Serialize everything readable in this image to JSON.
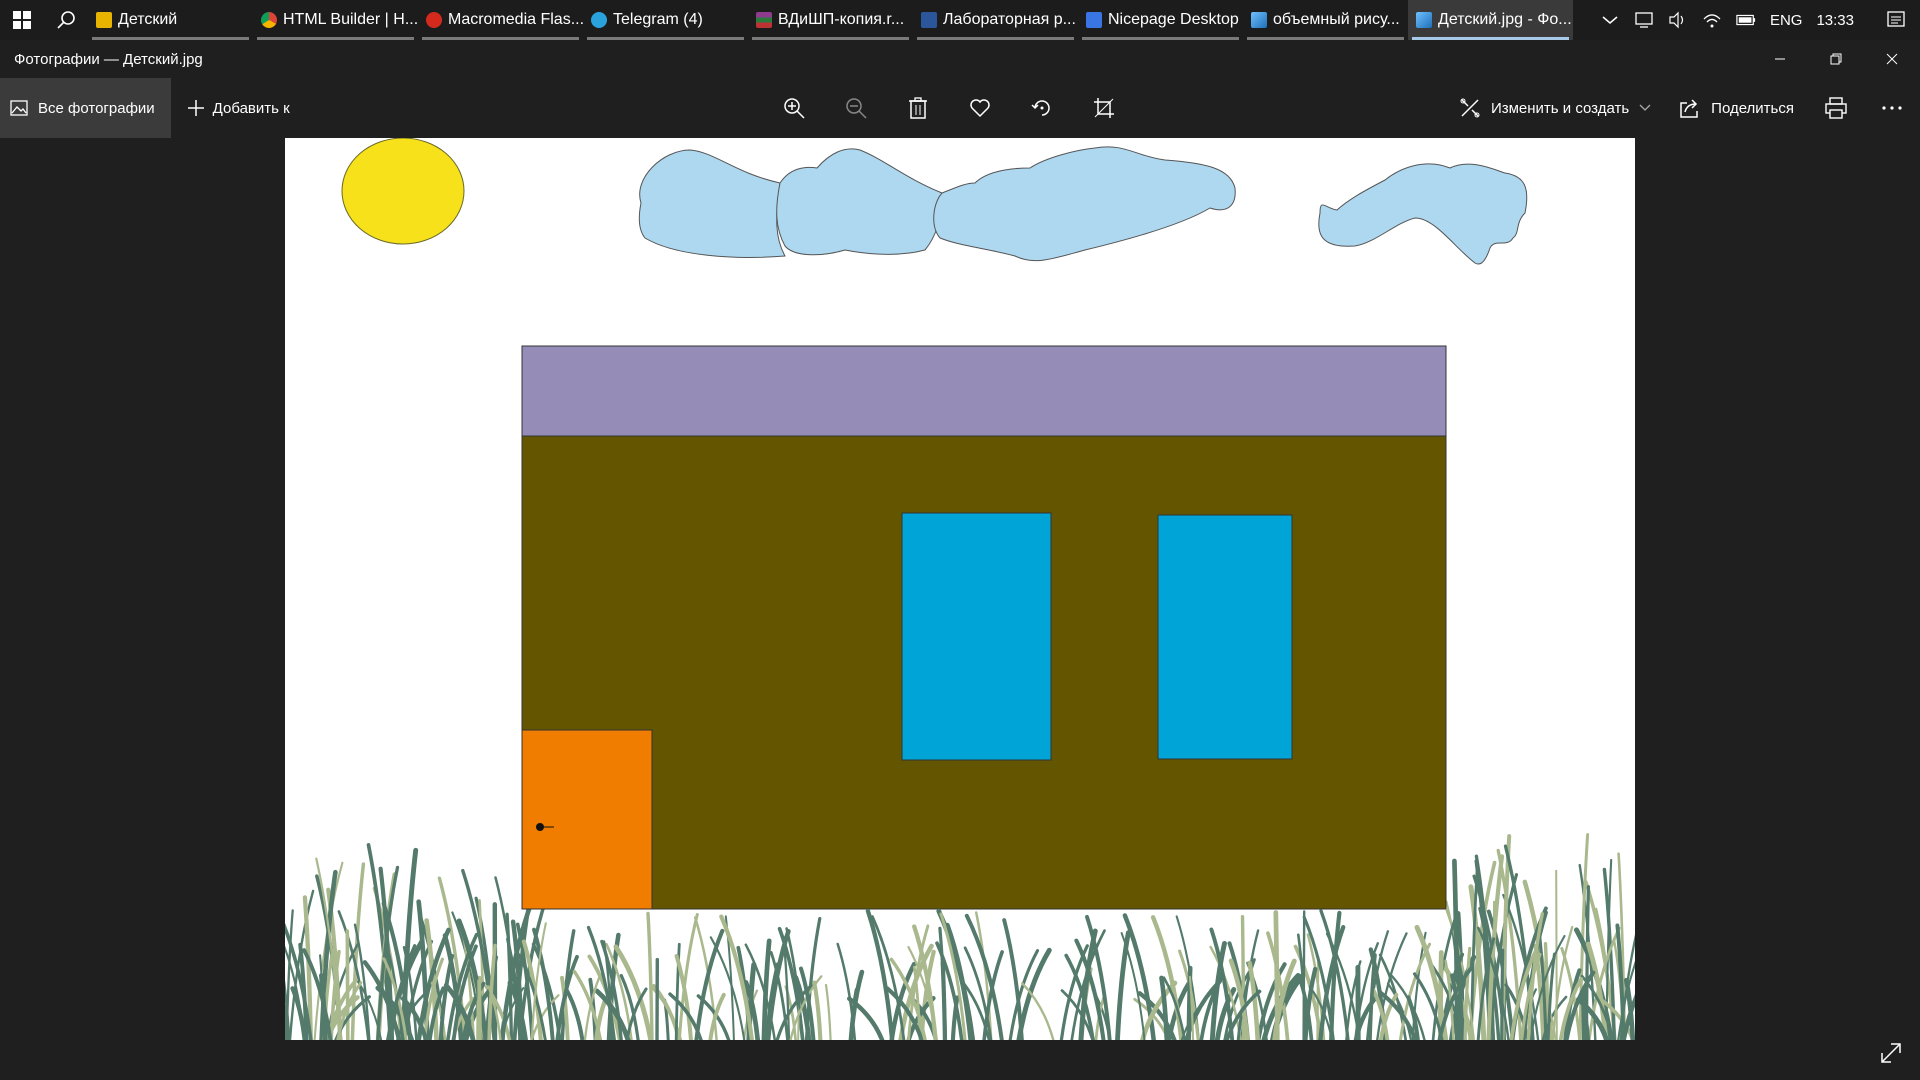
{
  "taskbar": {
    "tasks": [
      {
        "label": "Детский",
        "icon": "folder-icon",
        "color": "#e8b400"
      },
      {
        "label": "HTML Builder | H...",
        "icon": "chrome-icon",
        "color": "#4285f4"
      },
      {
        "label": "Macromedia Flas...",
        "icon": "flash-icon",
        "color": "#d42a1e"
      },
      {
        "label": "Telegram (4)",
        "icon": "telegram-icon",
        "color": "#2aa3dd"
      },
      {
        "label": "ВДиШП-копия.r...",
        "icon": "winrar-icon",
        "color": "#8e3b8e"
      },
      {
        "label": "Лабораторная р...",
        "icon": "word-icon",
        "color": "#2b579a"
      },
      {
        "label": "Nicepage Desktop",
        "icon": "nicepage-icon",
        "color": "#3a76e3"
      },
      {
        "label": "объемный рису...",
        "icon": "photos-icon",
        "color": "#3a8fd6"
      },
      {
        "label": "Детский.jpg - Фо...",
        "icon": "photos-icon",
        "color": "#3a8fd6"
      }
    ],
    "language": "ENG",
    "time": "13:33"
  },
  "titlebar": {
    "title": "Фотографии — Детский.jpg"
  },
  "toolbar": {
    "all_photos": "Все фотографии",
    "add_to": "Добавить к",
    "edit_create": "Изменить и создать",
    "share": "Поделиться"
  },
  "drawing": {
    "sun_color": "#f7e11a",
    "cloud_color": "#add8f0",
    "roof_color": "#958cb7",
    "wall_color": "#645600",
    "window_color": "#00a4d6",
    "door_color": "#f07d00",
    "grass_dark": "#537a6b",
    "grass_light": "#a9b88d"
  }
}
